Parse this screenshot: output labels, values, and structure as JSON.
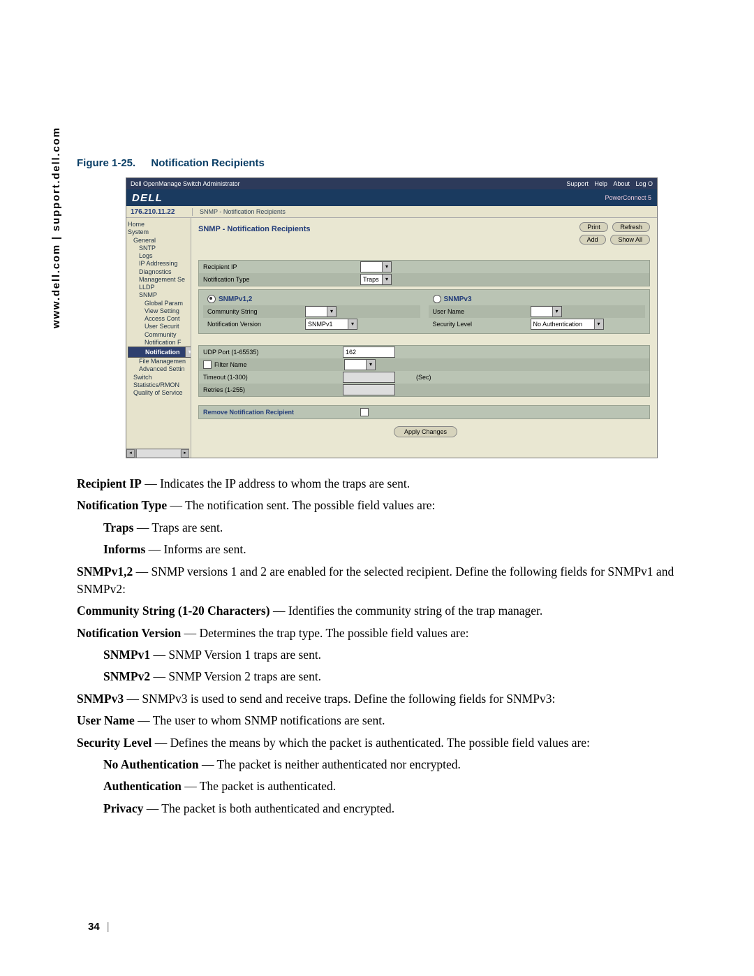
{
  "side_url": "www.dell.com | support.dell.com",
  "caption_num": "Figure 1-25.",
  "caption_title": "Notification Recipients",
  "screenshot": {
    "titlebar": {
      "app": "Dell OpenManage Switch Administrator",
      "links": [
        "Support",
        "Help",
        "About",
        "Log O"
      ]
    },
    "brand": "DELL",
    "product": "PowerConnect 5",
    "ip": "176.210.11.22",
    "breadcrumb": "SNMP - Notification Recipients",
    "tree": [
      {
        "t": "Home",
        "lv": 0
      },
      {
        "t": "System",
        "lv": 0
      },
      {
        "t": "General",
        "lv": 1
      },
      {
        "t": "SNTP",
        "lv": 2
      },
      {
        "t": "Logs",
        "lv": 2
      },
      {
        "t": "IP Addressing",
        "lv": 2
      },
      {
        "t": "Diagnostics",
        "lv": 2
      },
      {
        "t": "Management Se",
        "lv": 2
      },
      {
        "t": "LLDP",
        "lv": 2
      },
      {
        "t": "SNMP",
        "lv": 2
      },
      {
        "t": "Global Param",
        "lv": 3
      },
      {
        "t": "View Setting",
        "lv": 3
      },
      {
        "t": "Access Cont",
        "lv": 3
      },
      {
        "t": "User Securit",
        "lv": 3
      },
      {
        "t": "Community",
        "lv": 3
      },
      {
        "t": "Notification F",
        "lv": 3
      },
      {
        "t": "Notification",
        "lv": 3,
        "sel": true
      },
      {
        "t": "File Managemen",
        "lv": 2
      },
      {
        "t": "Advanced Settin",
        "lv": 2
      },
      {
        "t": "Switch",
        "lv": 1
      },
      {
        "t": "Statistics/RMON",
        "lv": 1
      },
      {
        "t": "Quality of Service",
        "lv": 1
      }
    ],
    "heading": "SNMP - Notification Recipients",
    "btns": {
      "print": "Print",
      "refresh": "Refresh",
      "add": "Add",
      "showall": "Show All"
    },
    "fields": {
      "recipient_ip": "Recipient IP",
      "notif_type": "Notification Type",
      "notif_type_val": "Traps",
      "snmpv12": "SNMPv1,2",
      "snmpv3": "SNMPv3",
      "community_string": "Community String",
      "notif_version": "Notification Version",
      "notif_version_val": "SNMPv1",
      "user_name": "User Name",
      "security_level": "Security Level",
      "security_level_val": "No Authentication",
      "udp_port": "UDP Port (1-65535)",
      "udp_port_val": "162",
      "filter_name": "Filter Name",
      "timeout": "Timeout (1-300)",
      "sec": "(Sec)",
      "retries": "Retries (1-255)",
      "remove": "Remove Notification Recipient",
      "apply": "Apply Changes"
    }
  },
  "doc": {
    "p1_b": "Recipient IP",
    "p1_t": " — Indicates the IP address to whom the traps are sent.",
    "p2_b": "Notification Type",
    "p2_t": " — The notification sent. The possible field values are:",
    "p3_b": "Traps",
    "p3_t": " — Traps are sent.",
    "p4_b": "Informs",
    "p4_t": " — Informs are sent.",
    "p5_b": "SNMPv1,2",
    "p5_t": " — SNMP versions 1 and 2 are enabled for the selected recipient. Define the following fields for SNMPv1 and SNMPv2:",
    "p6_b": "Community String (1-20 Characters)",
    "p6_t": " — Identifies the community string of the trap manager.",
    "p7_b": "Notification Version",
    "p7_t": " — Determines the trap type. The possible field values are:",
    "p8_b": "SNMPv1",
    "p8_t": " — SNMP Version 1 traps are sent.",
    "p9_b": "SNMPv2",
    "p9_t": " — SNMP Version 2 traps are sent.",
    "p10_b": "SNMPv3",
    "p10_t": " — SNMPv3 is used to send and receive traps. Define the following fields for SNMPv3:",
    "p11_b": "User Name",
    "p11_t": " — The user to whom SNMP notifications are sent.",
    "p12_b": "Security Level",
    "p12_t": " — Defines the means by which the packet is authenticated. The possible field values are:",
    "p13_b": "No Authentication",
    "p13_t": " — The packet is neither authenticated nor encrypted.",
    "p14_b": "Authentication",
    "p14_t": " — The packet is authenticated.",
    "p15_b": "Privacy",
    "p15_t": " — The packet is both authenticated and encrypted."
  },
  "page_number": "34"
}
